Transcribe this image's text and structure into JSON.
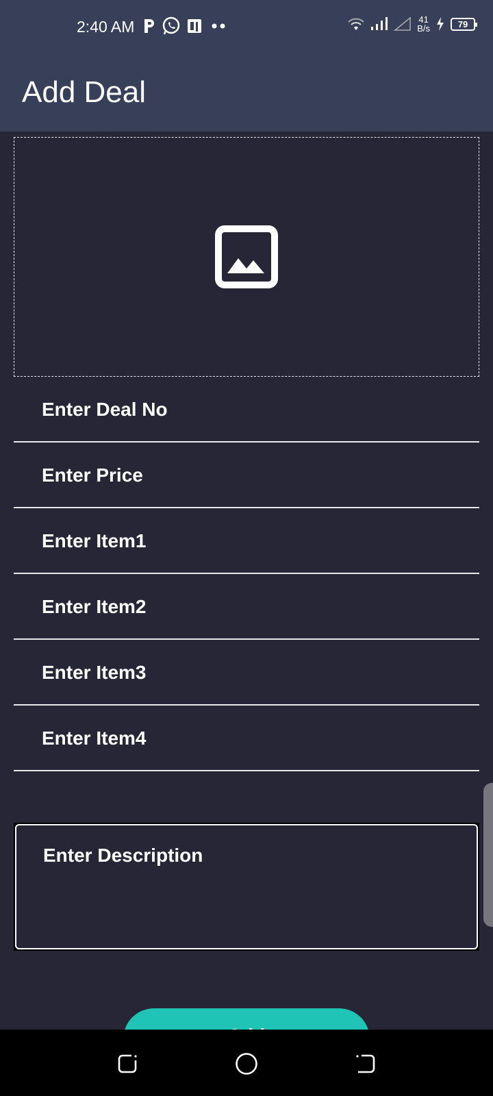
{
  "status_bar": {
    "time": "2:40 AM",
    "net_speed_value": "41",
    "net_speed_unit": "B/s",
    "battery": "79",
    "icons": [
      "parking-icon",
      "whatsapp-icon",
      "app-icon",
      "more-dots-icon",
      "wifi-icon",
      "signal-icon",
      "no-signal-icon",
      "charging-icon",
      "battery-icon"
    ]
  },
  "app_bar": {
    "title": "Add Deal"
  },
  "image_picker": {
    "icon": "image-icon"
  },
  "form": {
    "deal_no_placeholder": "Enter Deal No",
    "price_placeholder": "Enter Price",
    "item1_placeholder": "Enter Item1",
    "item2_placeholder": "Enter Item2",
    "item3_placeholder": "Enter Item3",
    "item4_placeholder": "Enter Item4",
    "description_placeholder": "Enter Description"
  },
  "add_button": {
    "label": "Add"
  },
  "nav_bar": {
    "icons": [
      "recents-icon",
      "home-icon",
      "back-icon"
    ]
  },
  "colors": {
    "app_bar": "#384059",
    "background": "#272636",
    "accent": "#1fc4b6"
  }
}
